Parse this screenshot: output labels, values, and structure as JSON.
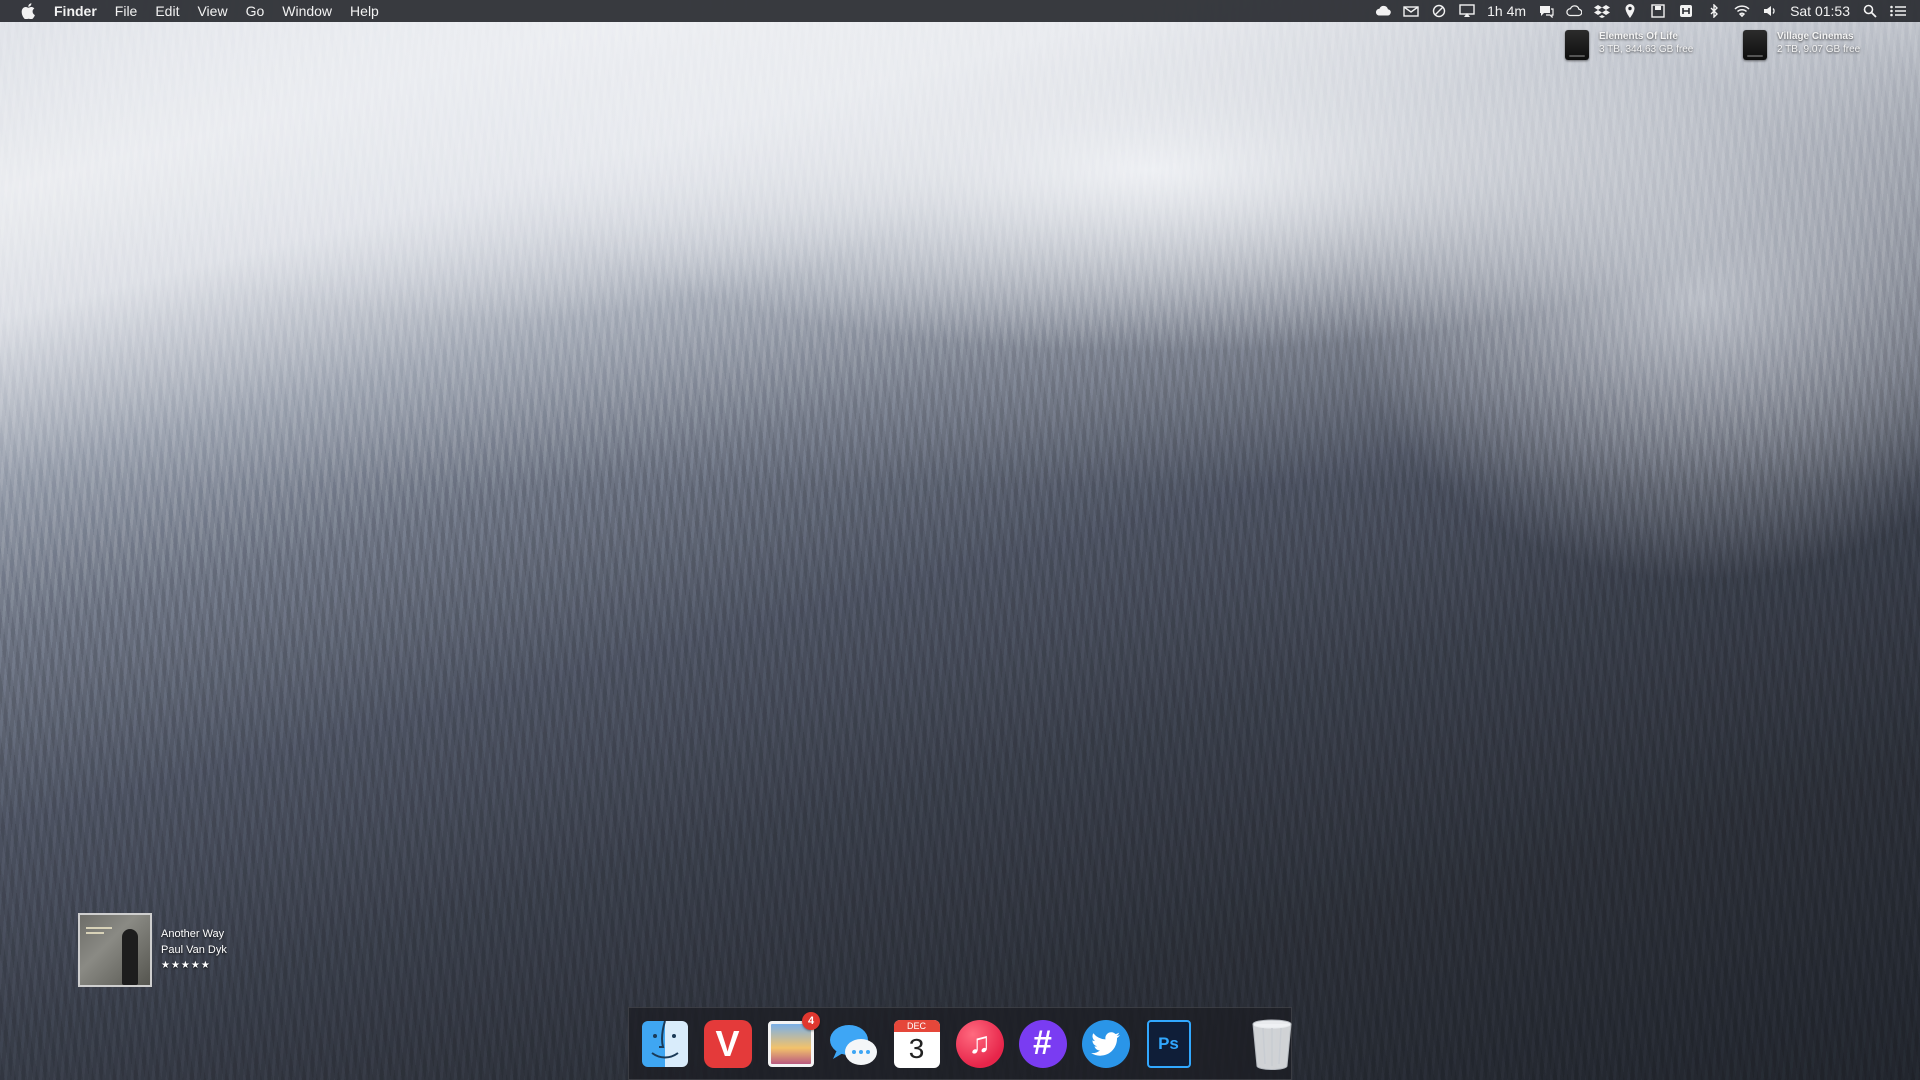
{
  "menubar": {
    "apple_icon": "apple-logo-icon",
    "app_name": "Finder",
    "menus": [
      "File",
      "Edit",
      "View",
      "Go",
      "Window",
      "Help"
    ],
    "status_icons": [
      "cloud-app-icon",
      "mail-activity-icon",
      "timer-icon",
      "airplay-icon"
    ],
    "battery_time": "1h 4m",
    "status_icons_2": [
      "messages-status-icon",
      "creative-cloud-icon",
      "dropbox-icon",
      "pin-icon",
      "backup-icon",
      "app-status-icon",
      "bluetooth-icon",
      "wifi-icon",
      "volume-icon"
    ],
    "clock": "Sat 01:53",
    "right_icons": [
      "spotlight-search-icon",
      "notification-center-icon"
    ]
  },
  "desktop": {
    "drives": [
      {
        "name": "Elements Of Life",
        "detail": "3 TB, 344.63 GB free",
        "icon": "external-drive-icon"
      },
      {
        "name": "Village Cinemas",
        "detail": "2 TB, 9.07 GB free",
        "icon": "external-drive-icon"
      }
    ],
    "now_playing": {
      "track": "Another Way",
      "artist": "Paul Van Dyk",
      "rating": "★★★★★"
    }
  },
  "dock": {
    "apps": [
      {
        "name": "Finder",
        "icon": "finder-icon"
      },
      {
        "name": "Vivaldi",
        "icon": "vivaldi-icon",
        "glyph": "V"
      },
      {
        "name": "Preview",
        "icon": "preview-icon",
        "badge": "4"
      },
      {
        "name": "Messages",
        "icon": "messages-icon"
      },
      {
        "name": "Calendar",
        "icon": "calendar-icon",
        "month": "DEC",
        "day": "3"
      },
      {
        "name": "Music",
        "icon": "music-icon",
        "glyph": "♫"
      },
      {
        "name": "Slack",
        "icon": "slack-icon",
        "glyph": "#"
      },
      {
        "name": "Twitter",
        "icon": "twitter-icon"
      },
      {
        "name": "Photoshop",
        "icon": "photoshop-icon",
        "glyph": "Ps"
      },
      {
        "name": "Trash",
        "icon": "trash-icon"
      }
    ]
  }
}
